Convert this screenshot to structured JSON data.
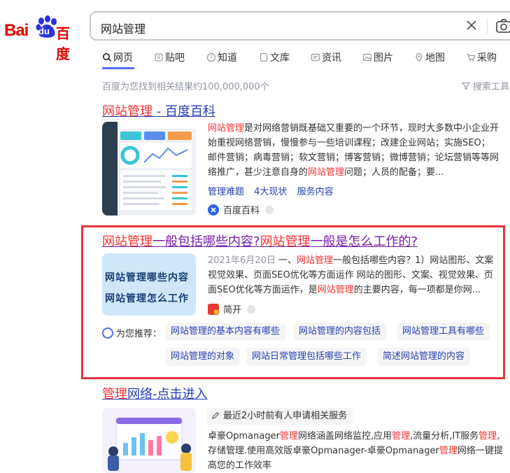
{
  "logo": {
    "bai": "Bai",
    "du": "du",
    "cn": "百度"
  },
  "search": {
    "query": "网站管理"
  },
  "tabs": [
    {
      "label": "网页",
      "icon": "search-icon"
    },
    {
      "label": "贴吧",
      "icon": "tieba-icon"
    },
    {
      "label": "知道",
      "icon": "question-icon"
    },
    {
      "label": "文库",
      "icon": "document-icon"
    },
    {
      "label": "资讯",
      "icon": "news-icon"
    },
    {
      "label": "图片",
      "icon": "image-icon"
    },
    {
      "label": "地图",
      "icon": "map-icon"
    },
    {
      "label": "采购",
      "icon": "cart-icon"
    }
  ],
  "result_count": "百度为您找到相关结果约100,000,000个",
  "search_tools": "搜索工具",
  "results": [
    {
      "title_em": "网站管理",
      "title_rest": " - 百度百科",
      "abstract": [
        {
          "em": "网站管理",
          "text": "是对网络营销既基础又重要的一个环节，现时大多数中小企业开"
        },
        {
          "em": "",
          "text": "始重视网络营销，慢慢参与一些培训课程；改建企业网站；实施SEO；"
        },
        {
          "em": "",
          "text": "邮件营销；病毒营销；软文营销；博客营销；微博营销；论坛营销等等网"
        },
        {
          "pre": "络推广，甚少注意自身的",
          "em": "网站管理",
          "text": "问题；人员的配备；要..."
        }
      ],
      "sublinks": [
        "管理难题",
        "4大现状",
        "服务内容"
      ],
      "source": "百度百科"
    },
    {
      "title_em1": "网站管理",
      "title_mid": "一般包括哪些内容?",
      "title_em2": "网站管理",
      "title_end": "一般是怎么工作的?",
      "thumb_lines": [
        "网站管理哪些内容",
        "网站管理怎么工作"
      ],
      "date": "2021年6月20日",
      "abstract": [
        {
          "pre": " 一、",
          "em": "网站管理",
          "text": "一般包括哪些内容？1）网站图形、文案"
        },
        {
          "pre": "视觉效果、页面SEO优化等方面运作 网站的图形、文案、视觉效果、页",
          "em": "",
          "text": ""
        },
        {
          "pre": "面SEO优化等方面运作，是",
          "em": "网站管理",
          "text": "的主要内容，每一项都是你网..."
        }
      ],
      "source": "简开",
      "recommend_label": "为您推荐：",
      "recommend": [
        "网站管理的基本内容有哪些",
        "网站管理的内容包括",
        "网站管理工具有哪些",
        "网站管理的对象",
        "网站日常管理包括哪些工作",
        "简述网站管理的内容"
      ]
    },
    {
      "title_em": "管理",
      "title_rest": "网络-点击进入",
      "tag": "最近2小时前有人申请相关服务",
      "abstract": [
        {
          "pre": "卓豪Opmanager",
          "em": "管理",
          "text": "网络涵盖网络监控,应用",
          "em2": "管理",
          "text2": ",流量分析,IT服务",
          "em3": "管理",
          "text3": ","
        },
        {
          "pre": "存储管理.使用高效版卓豪Opmanager-卓豪Opmanager",
          "em": "管理",
          "text": "网络一键提"
        },
        {
          "pre": "高您的工作效率",
          "em": "",
          "text": ""
        }
      ]
    }
  ],
  "colors": {
    "brand_red": "#e10601",
    "link_blue": "#2440b3",
    "highlight_red": "#f73131",
    "visited_purple": "#771caa",
    "accent_blue": "#4e6ef2"
  }
}
